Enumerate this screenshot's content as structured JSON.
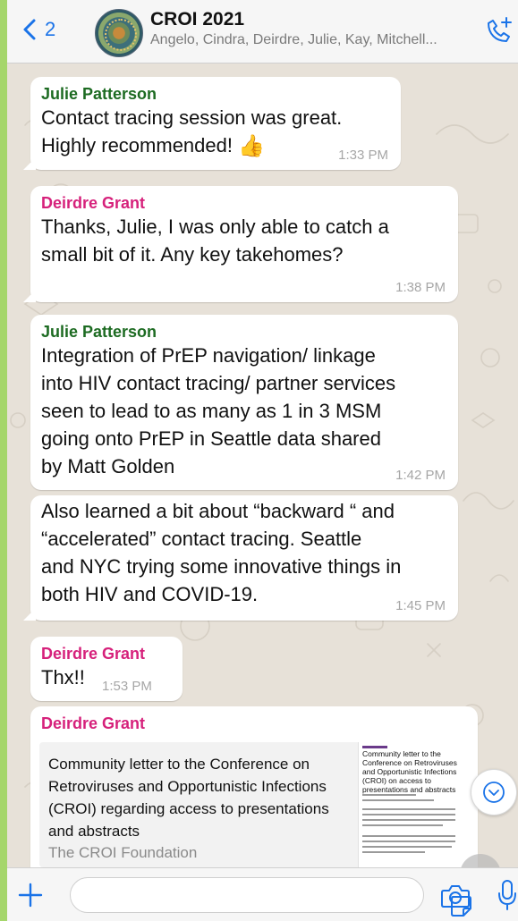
{
  "header": {
    "back_count": "2",
    "title": "CROI 2021",
    "subtitle": "Angelo, Cindra, Deirdre, Julie, Kay, Mitchell..."
  },
  "messages": [
    {
      "sender": "Julie Patterson",
      "text": "Contact tracing session was great.\nHighly recommended!",
      "emoji": "👍",
      "time": "1:33 PM"
    },
    {
      "sender": "Deirdre Grant",
      "text": "Thanks, Julie, I was only able to catch a\nsmall bit of it. Any key takehomes?",
      "time": "1:38 PM"
    },
    {
      "sender": "Julie Patterson",
      "text": "Integration of PrEP navigation/ linkage\ninto HIV contact tracing/ partner services\nseen to lead to as many as 1 in 3 MSM\ngoing onto PrEP in Seattle data shared\nby Matt Golden",
      "time": "1:42 PM"
    },
    {
      "text": "Also learned a bit about “backward “ and\n“accelerated” contact tracing. Seattle\nand NYC trying some innovative things in\nboth HIV and COVID-19.",
      "time": "1:45 PM"
    },
    {
      "sender": "Deirdre Grant",
      "text": "Thx!!",
      "time": "1:53 PM"
    },
    {
      "sender": "Deirdre Grant",
      "link": {
        "title": "Community letter to the Conference on Retroviruses and Opportunistic Infections (CROI) regarding access to presentations and abstracts",
        "source": "The CROI Foundation",
        "preview_title": "Community letter to the Conference on Retroviruses and Opportunistic Infections (CROI) on access to presentations and abstracts"
      }
    }
  ],
  "colors": {
    "accent": "#1a73e8",
    "sender_green": "#1d6b22",
    "sender_pink": "#d6217b",
    "chat_background": "#e7e1d8",
    "bubble": "#ffffff"
  },
  "icons": {
    "back": "chevron-left-icon",
    "call": "add-call-icon",
    "scroll": "chevron-down-icon",
    "plus": "plus-icon",
    "sticker": "sticker-icon",
    "camera": "camera-icon",
    "mic": "microphone-icon"
  }
}
